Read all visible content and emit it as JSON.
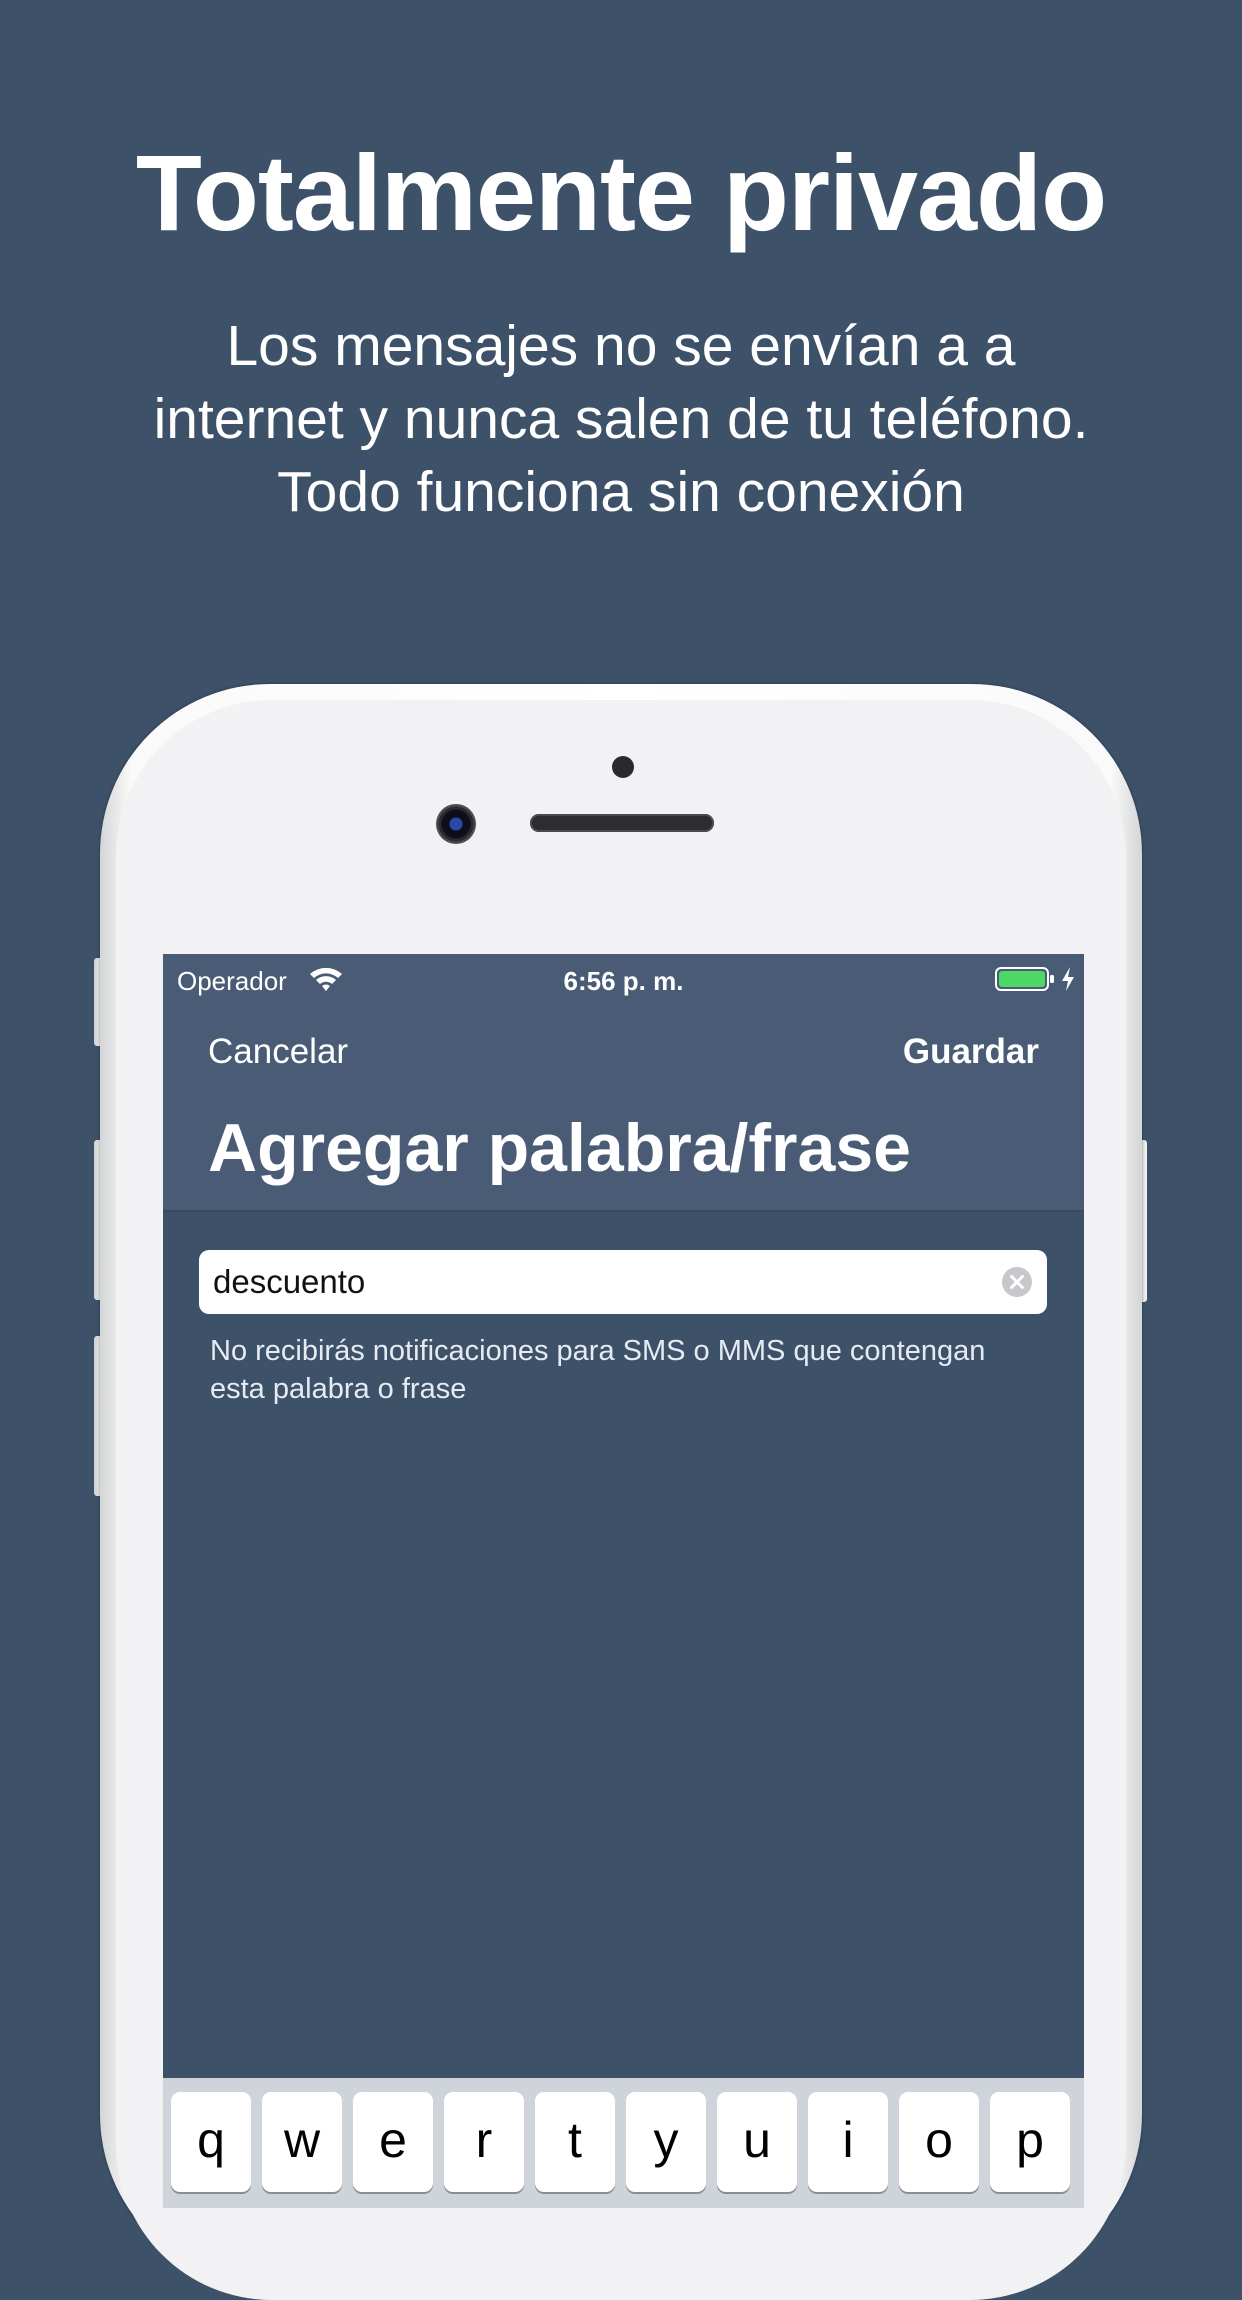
{
  "promo": {
    "title": "Totalmente privado",
    "subtitle": "Los mensajes no se envían a a\ninternet y nunca salen de tu teléfono.\nTodo funciona sin conexión"
  },
  "status_bar": {
    "carrier": "Operador",
    "time": "6:56 p. m.",
    "icons": [
      "wifi-icon",
      "battery-icon",
      "charging-icon"
    ],
    "battery_color": "#4cd964"
  },
  "navbar": {
    "cancel_label": "Cancelar",
    "save_label": "Guardar",
    "title": "Agregar palabra/frase"
  },
  "form": {
    "field_value": "descuento",
    "helper_text": "No recibirás notificaciones para SMS o MMS que contengan esta palabra o frase"
  },
  "keyboard": {
    "row1": [
      "q",
      "w",
      "e",
      "r",
      "t",
      "y",
      "u",
      "i",
      "o",
      "p"
    ]
  },
  "colors": {
    "background": "#3d5169",
    "navbar": "#4a5c75",
    "text": "#ffffff"
  }
}
